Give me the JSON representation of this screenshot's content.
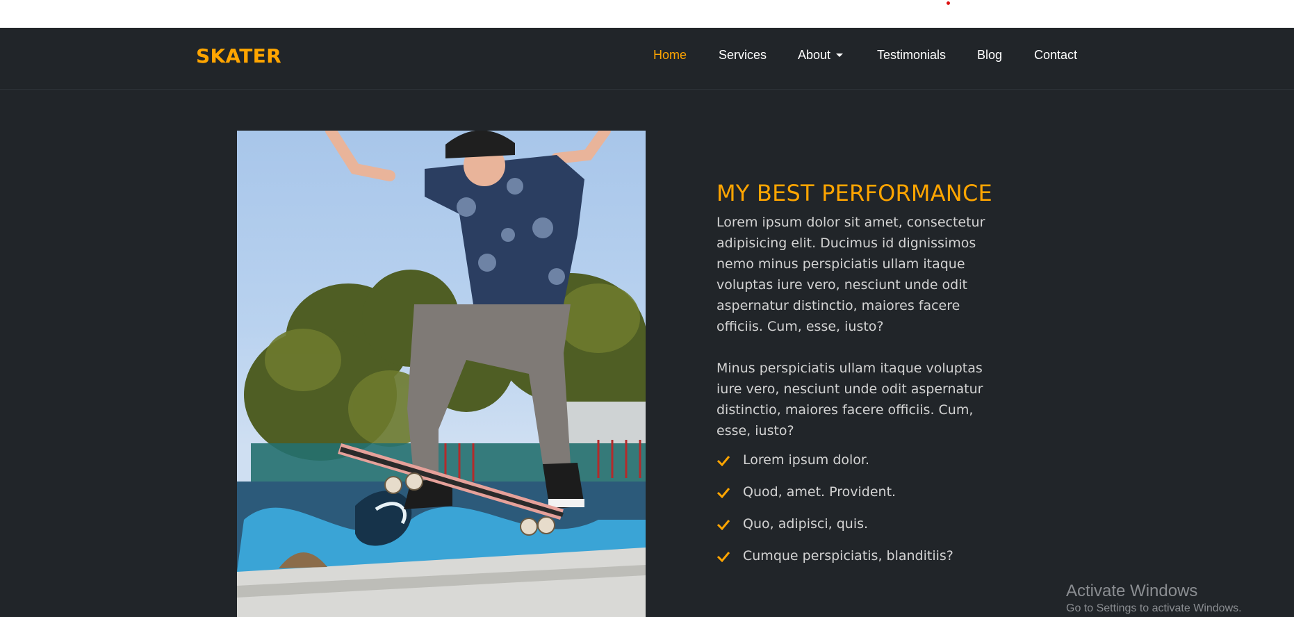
{
  "brand": "SKATER",
  "nav": {
    "items": [
      {
        "label": "Home"
      },
      {
        "label": "Services"
      },
      {
        "label": "About"
      },
      {
        "label": "Testimonials"
      },
      {
        "label": "Blog"
      },
      {
        "label": "Contact"
      }
    ]
  },
  "hero": {
    "image_alt": "Skateboarder performing a jump at a skatepark",
    "heading": "MY BEST PERFORMANCE",
    "paragraph1": "Lorem ipsum dolor sit amet, consectetur adipisicing elit. Ducimus id dignissimos nemo minus perspiciatis ullam itaque voluptas iure vero, nesciunt unde odit aspernatur distinctio, maiores facere officiis. Cum, esse, iusto?",
    "paragraph2": "Minus perspiciatis ullam itaque voluptas iure vero, nesciunt unde odit aspernatur distinctio, maiores facere officiis. Cum, esse, iusto?",
    "features": [
      "Lorem ipsum dolor.",
      "Quod, amet. Provident.",
      "Quo, adipisci, quis.",
      "Cumque perspiciatis, blanditiis?"
    ]
  },
  "watermark": {
    "line1": "Activate Windows",
    "line2": "Go to Settings to activate Windows."
  },
  "colors": {
    "accent": "#ffa500",
    "background": "#212529",
    "text": "#d3d3d3"
  },
  "icons": {
    "feature_bullet": "check-icon",
    "dropdown": "caret-down-icon"
  }
}
